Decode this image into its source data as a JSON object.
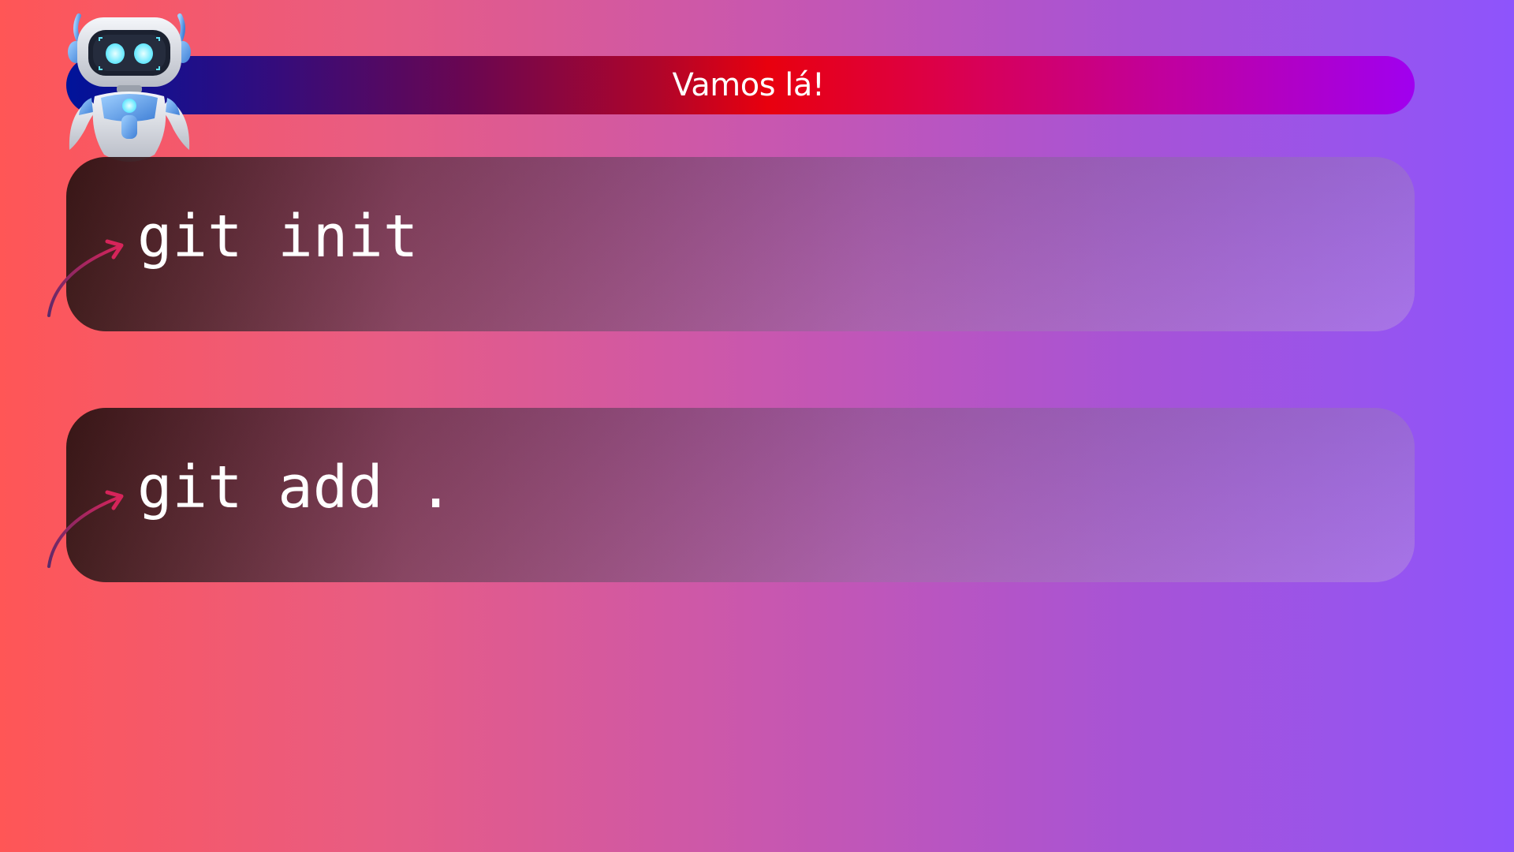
{
  "banner": {
    "title": "Vamos lá!"
  },
  "mascot": {
    "icon": "robot-mascot-icon"
  },
  "commands": [
    {
      "text": "git init",
      "icon": "curved-arrow-icon"
    },
    {
      "text": "git add .",
      "icon": "curved-arrow-icon"
    }
  ],
  "colors": {
    "background_start": "#ff5656",
    "background_end": "#8e54fc",
    "banner_start": "#00139a",
    "banner_mid": "#e8000e",
    "banner_end": "#a000ef",
    "arrow": "#d6245a",
    "text": "#ffffff"
  }
}
